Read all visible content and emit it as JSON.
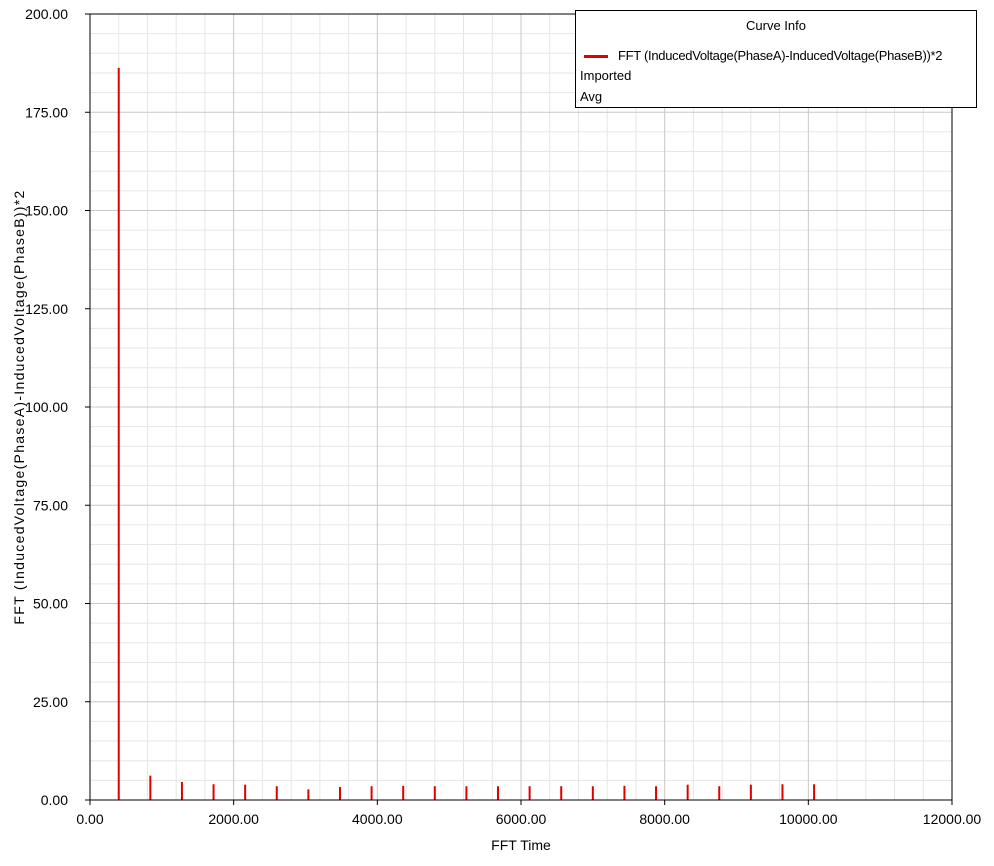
{
  "chart_data": {
    "type": "bar",
    "xlabel": "FFT Time",
    "ylabel": "FFT (InducedVoltage(PhaseA)-InducedVoltage(PhaseB))*2",
    "xlim": [
      0,
      12000
    ],
    "ylim": [
      0,
      200
    ],
    "x_ticks": [
      "0.00",
      "2000.00",
      "4000.00",
      "6000.00",
      "8000.00",
      "10000.00",
      "12000.00"
    ],
    "y_ticks": [
      "0.00",
      "25.00",
      "50.00",
      "75.00",
      "100.00",
      "125.00",
      "150.00",
      "175.00",
      "200.00"
    ],
    "grid": true,
    "legend_position": "top-right",
    "series": [
      {
        "name": "FFT (InducedVoltage(PhaseA)-InducedVoltage(PhaseB))*2",
        "color": "#e00000",
        "x": [
          400,
          840,
          1280,
          1720,
          2160,
          2600,
          3040,
          3480,
          3920,
          4360,
          4800,
          5240,
          5680,
          6120,
          6560,
          7000,
          7440,
          7880,
          8320,
          8760,
          9200,
          9640,
          10080
        ],
        "values": [
          186.3,
          6.2,
          4.6,
          4.0,
          3.9,
          3.5,
          2.7,
          3.3,
          3.5,
          3.6,
          3.5,
          3.5,
          3.5,
          3.5,
          3.5,
          3.5,
          3.6,
          3.5,
          3.9,
          3.5,
          3.9,
          4.0,
          4.0
        ]
      }
    ]
  },
  "legend": {
    "title": "Curve Info",
    "series_name": "FFT (InducedVoltage(PhaseA)-InducedVoltage(PhaseB))*2",
    "line1": "Imported",
    "line2": "Avg"
  }
}
